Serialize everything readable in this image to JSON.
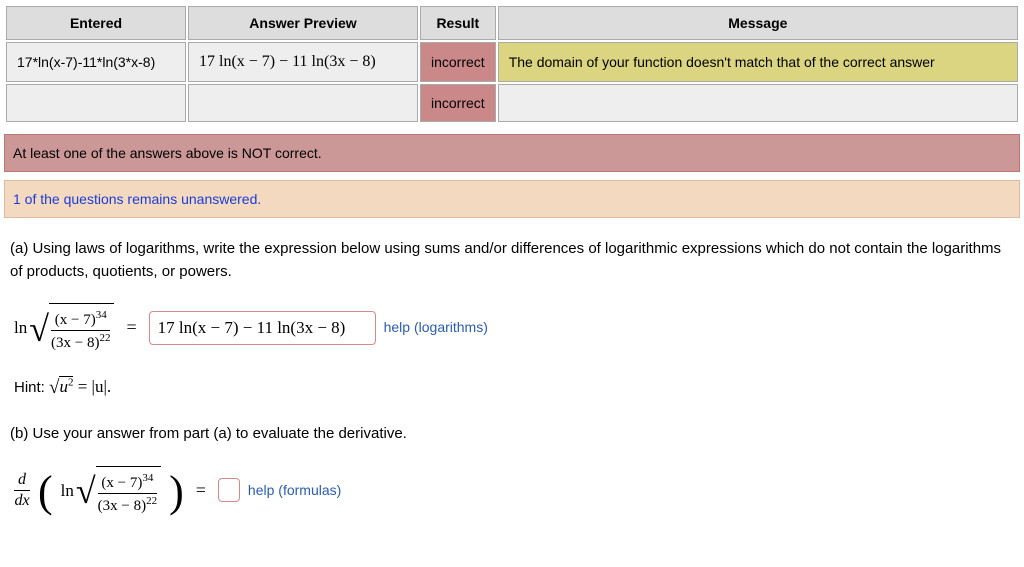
{
  "table": {
    "headers": {
      "entered": "Entered",
      "preview": "Answer Preview",
      "result": "Result",
      "message": "Message"
    },
    "rows": [
      {
        "entered": "17*ln(x-7)-11*ln(3*x-8)",
        "preview": "17 ln(x − 7) − 11 ln(3x − 8)",
        "result": "incorrect",
        "message": "The domain of your function doesn't match that of the correct answer"
      },
      {
        "entered": "",
        "preview": "",
        "result": "incorrect",
        "message": ""
      }
    ]
  },
  "alerts": {
    "error": "At least one of the answers above is NOT correct.",
    "warn": "1 of the questions remains unanswered."
  },
  "question": {
    "a_text": "(a) Using laws of logarithms, write the expression below using sums and/or differences of logarithmic expressions which do not contain the logarithms of products, quotients, or powers.",
    "b_text": "(b) Use your answer from part (a) to evaluate the derivative.",
    "expr": {
      "ln": "ln",
      "num_base": "(x − 7)",
      "num_exp": "34",
      "den_base": "(3x − 8)",
      "den_exp": "22"
    },
    "answer_a": "17 ln(x − 7) − 11 ln(3x − 8)",
    "help_log": "help (logarithms)",
    "hint_label": "Hint: ",
    "hint_math_lhs_sqrt": "u",
    "hint_math_lhs_exp": "2",
    "hint_eq": " = ",
    "hint_math_rhs": "|u|.",
    "d_label": "d",
    "dx_label": "dx",
    "eq": "=",
    "answer_b": "",
    "help_formulas": "help (formulas)"
  }
}
